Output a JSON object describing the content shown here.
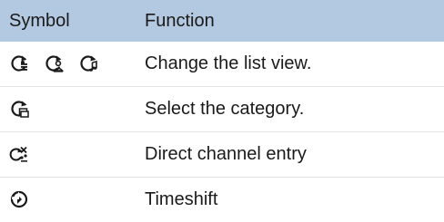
{
  "header": {
    "symbol": "Symbol",
    "function": "Function"
  },
  "rows": [
    {
      "icons": [
        "list-view-icon",
        "list-view-person-icon",
        "list-view-music-icon"
      ],
      "function": "Change the list view."
    },
    {
      "icons": [
        "category-icon"
      ],
      "function": "Select the category."
    },
    {
      "icons": [
        "direct-channel-entry-icon"
      ],
      "function": "Direct channel entry"
    },
    {
      "icons": [
        "timeshift-icon"
      ],
      "function": "Timeshift"
    }
  ]
}
